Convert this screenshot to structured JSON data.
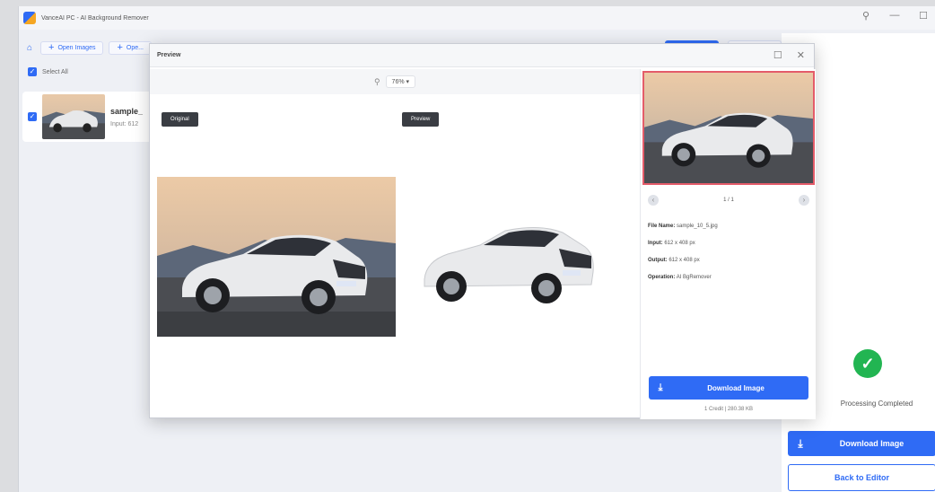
{
  "app": {
    "title": "VanceAI PC - AI Background Remover",
    "window_controls": [
      "pin",
      "minimize",
      "maximize"
    ]
  },
  "toolbar": {
    "open_images_label": "Open Images",
    "open_folder_label": "Ope..."
  },
  "left_panel": {
    "select_all_label": "Select All",
    "file": {
      "name": "sample_",
      "input": "Input: 612"
    }
  },
  "dialog": {
    "title": "Preview",
    "zoom_value": "76%",
    "original_tag": "Original",
    "preview_tag": "Preview",
    "pager_text": "1 / 1",
    "info": {
      "file_name_label": "File Name:",
      "file_name_value": "sample_10_5.jpg",
      "input_label": "Input:",
      "input_value": "612 x 408 px",
      "output_label": "Output:",
      "output_value": "612 x 408 px",
      "operation_label": "Operation:",
      "operation_value": "AI BgRemover"
    },
    "download_label": "Download Image",
    "credit_line": "1 Credit | 280.38 KB"
  },
  "right_panel": {
    "status_text": "Processing Completed",
    "download_label": "Download Image",
    "back_label": "Back to Editor"
  },
  "colors": {
    "accent": "#2f6bf5",
    "success": "#22b552",
    "selection_border": "#e45c6a"
  }
}
